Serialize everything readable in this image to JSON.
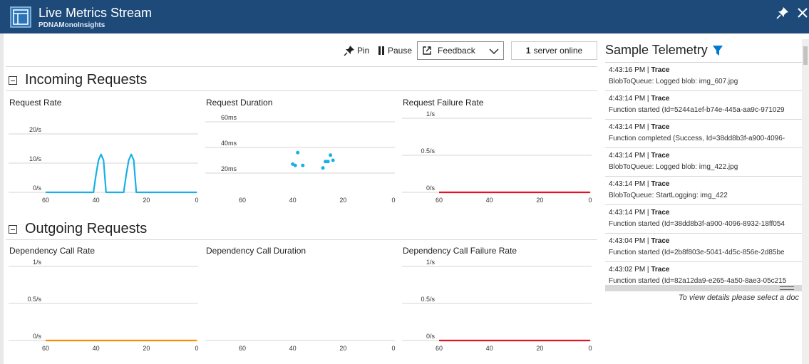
{
  "window": {
    "title": "Live Metrics Stream",
    "subtitle": "PDNAMonoInsights"
  },
  "toolbar": {
    "pin_label": "Pin",
    "pause_label": "Pause",
    "feedback_label": "Feedback",
    "server_count": "1",
    "server_text": "server online"
  },
  "sections": {
    "incoming": "Incoming Requests",
    "outgoing": "Outgoing Requests"
  },
  "charts": {
    "request_rate": {
      "title": "Request Rate",
      "y_ticks": [
        "0/s",
        "10/s",
        "20/s"
      ],
      "x_ticks": [
        "60",
        "40",
        "20",
        "0"
      ]
    },
    "request_duration": {
      "title": "Request Duration",
      "y_ticks": [
        "20ms",
        "40ms",
        "60ms"
      ],
      "x_ticks": [
        "60",
        "40",
        "20",
        "0"
      ]
    },
    "request_failure_rate": {
      "title": "Request Failure Rate",
      "y_ticks": [
        "0/s",
        "0.5/s",
        "1/s"
      ],
      "x_ticks": [
        "60",
        "40",
        "20",
        "0"
      ]
    },
    "dependency_call_rate": {
      "title": "Dependency Call Rate",
      "y_ticks": [
        "0/s",
        "0.5/s",
        "1/s"
      ],
      "x_ticks": [
        "60",
        "40",
        "20",
        "0"
      ]
    },
    "dependency_call_duration": {
      "title": "Dependency Call Duration",
      "x_ticks": [
        "60",
        "40",
        "20",
        "0"
      ]
    },
    "dependency_call_failure_rate": {
      "title": "Dependency Call Failure Rate",
      "y_ticks": [
        "0/s",
        "0.5/s",
        "1/s"
      ],
      "x_ticks": [
        "60",
        "40",
        "20",
        "0"
      ]
    }
  },
  "chart_data": [
    {
      "type": "line",
      "title": "Request Rate",
      "xlim": [
        60,
        0
      ],
      "ylim": [
        0,
        20
      ],
      "color": "#1aafe6",
      "x": [
        60,
        41,
        40,
        39,
        38,
        37,
        36,
        29,
        28,
        27,
        26,
        25,
        24,
        0
      ],
      "y": [
        0,
        0,
        6,
        11,
        13,
        11,
        0,
        0,
        6,
        11,
        13,
        11,
        0,
        0
      ]
    },
    {
      "type": "scatter",
      "title": "Request Duration",
      "xlim": [
        60,
        0
      ],
      "ylim": [
        20,
        60
      ],
      "color": "#1aafe6",
      "x": [
        40,
        39,
        38,
        36,
        28,
        27,
        26,
        25,
        24
      ],
      "y": [
        27,
        26,
        36,
        26,
        24,
        29,
        29,
        34,
        30
      ]
    },
    {
      "type": "line",
      "title": "Request Failure Rate",
      "xlim": [
        60,
        0
      ],
      "ylim": [
        0,
        1
      ],
      "color": "#e81123",
      "x": [
        60,
        0
      ],
      "y": [
        0,
        0
      ]
    },
    {
      "type": "line",
      "title": "Dependency Call Rate",
      "xlim": [
        60,
        0
      ],
      "ylim": [
        0,
        1
      ],
      "color": "#ff8c00",
      "x": [
        60,
        0
      ],
      "y": [
        0,
        0
      ]
    },
    {
      "type": "line",
      "title": "Dependency Call Duration",
      "xlim": [
        60,
        0
      ],
      "x": [],
      "y": []
    },
    {
      "type": "line",
      "title": "Dependency Call Failure Rate",
      "xlim": [
        60,
        0
      ],
      "ylim": [
        0,
        1
      ],
      "color": "#e81123",
      "x": [
        60,
        0
      ],
      "y": [
        0,
        0
      ]
    }
  ],
  "telemetry": {
    "title": "Sample Telemetry",
    "items": [
      {
        "time": "4:43:16 PM",
        "type": "Trace",
        "message": "BlobToQueue: Logged blob: img_607.jpg"
      },
      {
        "time": "4:43:14 PM",
        "type": "Trace",
        "message": "Function started (Id=5244a1ef-b74e-445a-aa9c-971029"
      },
      {
        "time": "4:43:14 PM",
        "type": "Trace",
        "message": "Function completed (Success, Id=38dd8b3f-a900-4096-"
      },
      {
        "time": "4:43:14 PM",
        "type": "Trace",
        "message": "BlobToQueue: Logged blob: img_422.jpg"
      },
      {
        "time": "4:43:14 PM",
        "type": "Trace",
        "message": "BlobToQueue: StartLogging: img_422"
      },
      {
        "time": "4:43:14 PM",
        "type": "Trace",
        "message": "Function started (Id=38dd8b3f-a900-4096-8932-18ff054"
      },
      {
        "time": "4:43:04 PM",
        "type": "Trace",
        "message": "Function started (Id=2b8f803e-5041-4d5c-856e-2d85be"
      },
      {
        "time": "4:43:02 PM",
        "type": "Trace",
        "message": "Function started (Id=82a12da9-e265-4a50-8ae3-05c215"
      }
    ],
    "hint": "To view details please select a doc"
  },
  "icons": {
    "app": "live-metrics-icon",
    "pin": "pin-icon",
    "close": "close-icon",
    "pause": "pause-icon",
    "feedback": "external-link-icon",
    "filter": "filter-icon",
    "chevron": "chevron-down-icon",
    "collapse": "collapse-icon"
  },
  "colors": {
    "titlebar": "#1e4a7a",
    "series_blue": "#1aafe6",
    "failure_red": "#e81123",
    "dependency_orange": "#ff8c00",
    "filter_blue": "#0078d4"
  }
}
